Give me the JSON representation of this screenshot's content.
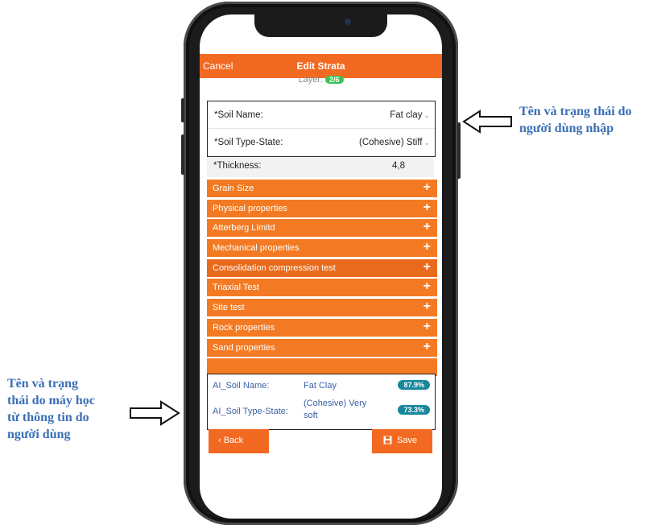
{
  "header": {
    "cancel_label": "Cancel",
    "title": "Edit Strata"
  },
  "layer": {
    "label": "Layer:",
    "badge": "2/6"
  },
  "user_input": {
    "soil_name_label": "*Soil Name:",
    "soil_name_value": "Fat clay",
    "soil_type_label": "*Soil Type-State:",
    "soil_type_value": "(Cohesive) Stiff"
  },
  "thickness": {
    "label": "*Thickness:",
    "value": "4,8"
  },
  "sections": [
    "Grain Size",
    "Physical properties",
    "Atterberg Limitd",
    "Mechanical properties",
    "Consolidation compression test",
    "Triaxial Test",
    "Site test",
    "Rock properties",
    "Sand properties"
  ],
  "ai": {
    "soil_name_label": "AI_Soil Name:",
    "soil_name_value": "Fat Clay",
    "soil_name_pct": "87.9%",
    "soil_type_label": "AI_Soil Type-State:",
    "soil_type_value_line1": "(Cohesive) Very",
    "soil_type_value_line2": "soft",
    "soil_type_pct": "73.3%"
  },
  "buttons": {
    "back_label": "‹ Back",
    "save_label": "Save"
  },
  "annotations": {
    "right_line1": "Tên và trạng thái do",
    "right_line2": "người dùng nhập",
    "left_line1": "Tên và trạng",
    "left_line2": "thái do máy học",
    "left_line3": "từ thông tin do",
    "left_line4": "người dùng"
  },
  "colors": {
    "accent": "#f26a22",
    "badge_green": "#3cc351",
    "pct_teal": "#17889b",
    "annotation_blue": "#3a6fb5"
  }
}
